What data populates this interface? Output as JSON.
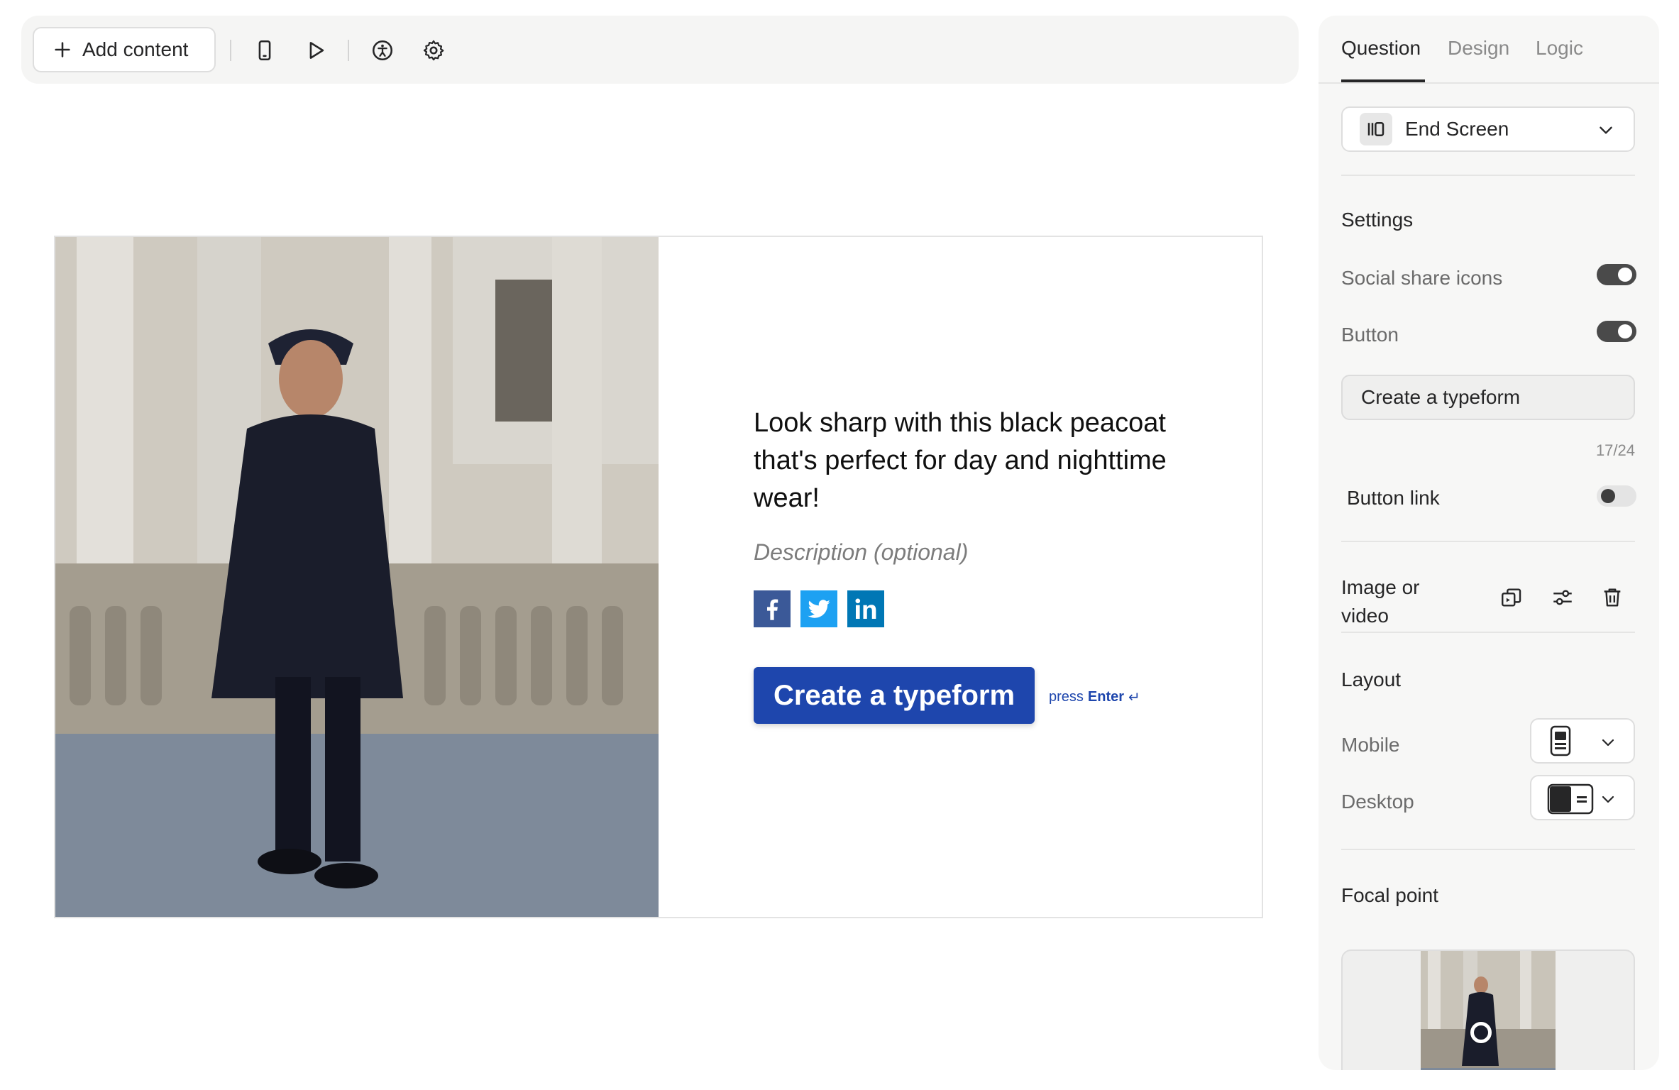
{
  "toolbar": {
    "add_content_label": "Add content",
    "icons": [
      "plus-icon",
      "mobile-preview-icon",
      "play-icon",
      "accessibility-icon",
      "gear-icon"
    ]
  },
  "preview": {
    "image_alt": "Man in black peacoat walking past stone columns",
    "title": "Look sharp with this black peacoat that's perfect for day and nighttime wear!",
    "description_placeholder": "Description (optional)",
    "social_icons": [
      "facebook-icon",
      "twitter-icon",
      "linkedin-icon"
    ],
    "button_label": "Create a typeform",
    "press_text": "press",
    "press_key": "Enter",
    "press_symbol": "↵",
    "button_color": "#1e46ad"
  },
  "panel": {
    "tabs": [
      {
        "label": "Question",
        "active": true
      },
      {
        "label": "Design",
        "active": false
      },
      {
        "label": "Logic",
        "active": false
      }
    ],
    "question_type": "End Screen",
    "settings": {
      "heading": "Settings",
      "social_share_label": "Social share icons",
      "social_share_on": true,
      "button_label": "Button",
      "button_on": true,
      "button_text_value": "Create a typeform",
      "button_text_counter": "17/24",
      "button_link_label": "Button link",
      "button_link_on": false
    },
    "media": {
      "label_line1": "Image or",
      "label_line2": "video",
      "actions": [
        "replace-media-icon",
        "adjust-icon",
        "trash-icon"
      ]
    },
    "layout": {
      "heading": "Layout",
      "mobile_label": "Mobile",
      "desktop_label": "Desktop"
    },
    "focal_point": {
      "heading": "Focal point"
    }
  }
}
